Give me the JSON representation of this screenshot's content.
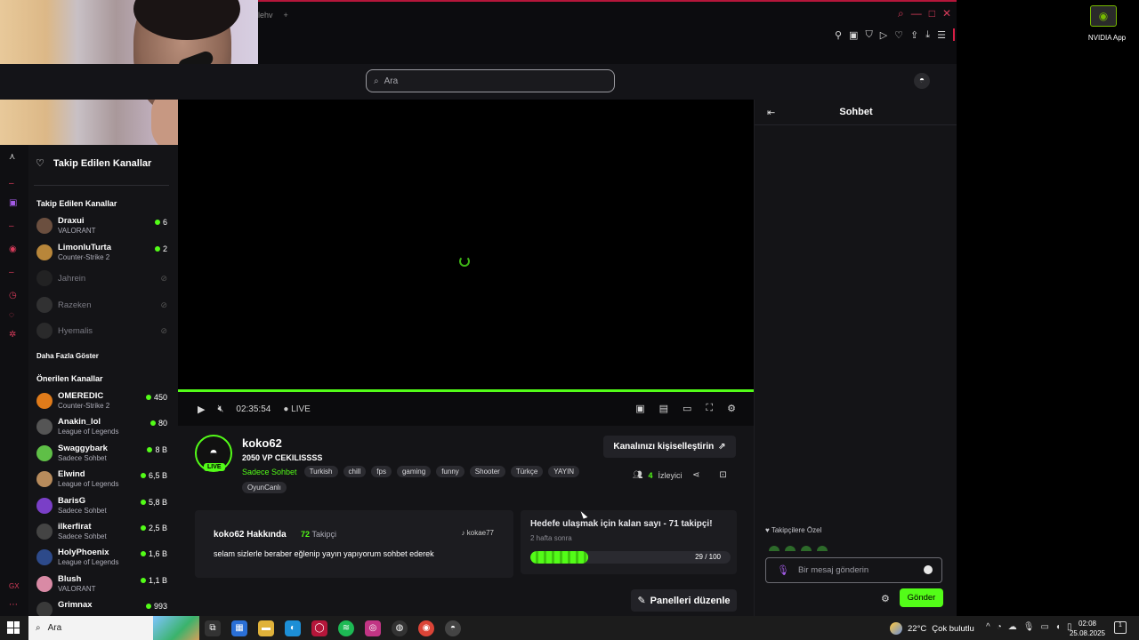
{
  "browser": {
    "tab_text": "lehv",
    "new_tab_icon": "plus-icon",
    "window_controls": [
      "search-icon",
      "minimize-icon",
      "maximize-icon",
      "close-icon"
    ],
    "toolbar_icons": [
      "pin-icon",
      "screenshot-icon",
      "shield-icon",
      "play-icon",
      "heart-icon",
      "upload-icon",
      "download-icon",
      "menu-icon"
    ]
  },
  "header": {
    "search_placeholder": "Ara"
  },
  "sidebar": {
    "followed_button": "Takip Edilen Kanallar",
    "followed_title": "Takip Edilen Kanallar",
    "followed": [
      {
        "name": "Draxui",
        "game": "VALORANT",
        "viewers": "6",
        "online": true,
        "color": "#6b4f3f"
      },
      {
        "name": "LimonluTurta",
        "game": "Counter-Strike 2",
        "viewers": "2",
        "online": true,
        "color": "#b8863a"
      },
      {
        "name": "Jahrein",
        "game": "",
        "viewers": "",
        "online": false,
        "color": "#333"
      },
      {
        "name": "Razeken",
        "game": "",
        "viewers": "",
        "online": false,
        "color": "#555"
      },
      {
        "name": "Hyemalis",
        "game": "",
        "viewers": "",
        "online": false,
        "color": "#444"
      }
    ],
    "show_more": "Daha Fazla Göster",
    "recommended_title": "Önerilen Kanallar",
    "recommended": [
      {
        "name": "OMEREDIC",
        "game": "Counter-Strike 2",
        "viewers": "450",
        "color": "#e07b1a"
      },
      {
        "name": "Anakin_lol",
        "game": "League of Legends",
        "viewers": "80",
        "color": "#555"
      },
      {
        "name": "Swaggybark",
        "game": "Sadece Sohbet",
        "viewers": "8 B",
        "color": "#5fbf47"
      },
      {
        "name": "Elwind",
        "game": "League of Legends",
        "viewers": "6,5 B",
        "color": "#b78b5c"
      },
      {
        "name": "BarisG",
        "game": "Sadece Sohbet",
        "viewers": "5,8 B",
        "color": "#7a3fc7"
      },
      {
        "name": "ilkerfirat",
        "game": "Sadece Sohbet",
        "viewers": "2,5 B",
        "color": "#444"
      },
      {
        "name": "HolyPhoenix",
        "game": "League of Legends",
        "viewers": "1,6 B",
        "color": "#2d4a8a"
      },
      {
        "name": "Blush",
        "game": "VALORANT",
        "viewers": "1,1 B",
        "color": "#d98aa5"
      },
      {
        "name": "Grimnax",
        "game": "",
        "viewers": "993",
        "color": "#3a3a3a"
      }
    ]
  },
  "player": {
    "time": "02:35:54",
    "live_label": "LIVE",
    "icons": [
      "play-icon",
      "mute-icon",
      "pip-icon",
      "theater-icon",
      "miniplayer-icon",
      "fullscreen-icon",
      "settings-icon"
    ]
  },
  "channel": {
    "name": "koko62",
    "live_badge": "LIVE",
    "title": "2050 VP CEKILISSSS",
    "category": "Sadece Sohbet",
    "tags": [
      "Turkish",
      "chill",
      "fps",
      "gaming",
      "funny",
      "Shooter",
      "Türkçe",
      "YAYIN",
      "OyunCanlı"
    ],
    "customize_button": "Kanalınızı kişiselleştirin",
    "viewer_count": "4",
    "viewer_label": "İzleyici",
    "about_title": "koko62 Hakkında",
    "follower_count": "72",
    "follower_label": "Takipçi",
    "tiktok": "kokae77",
    "description": "selam sizlerle beraber eğlenip yayın yapıyorum sohbet ederek",
    "goal_title": "Hedefe ulaşmak için kalan sayı - 71 takipçi!",
    "goal_subtitle": "2 hafta sonra",
    "goal_progress": "29 / 100",
    "goal_fraction": 0.29,
    "edit_panels_button": "Panelleri düzenle"
  },
  "chat": {
    "title": "Sohbet",
    "followers_only": "Takipçilere Özel",
    "input_placeholder": "Bir mesaj gönderin",
    "send_button": "Gönder"
  },
  "desktop": {
    "nvidia_label": "NVIDIA App"
  },
  "taskbar": {
    "search_text": "Ara",
    "weather": "22°C",
    "weather_desc": "Çok bulutlu",
    "time": "02:08",
    "date": "25.08.2025",
    "notification_count": "1"
  },
  "colors": {
    "accent": "#53fc18",
    "browser_accent": "#d63b5a",
    "background": "#141417"
  }
}
